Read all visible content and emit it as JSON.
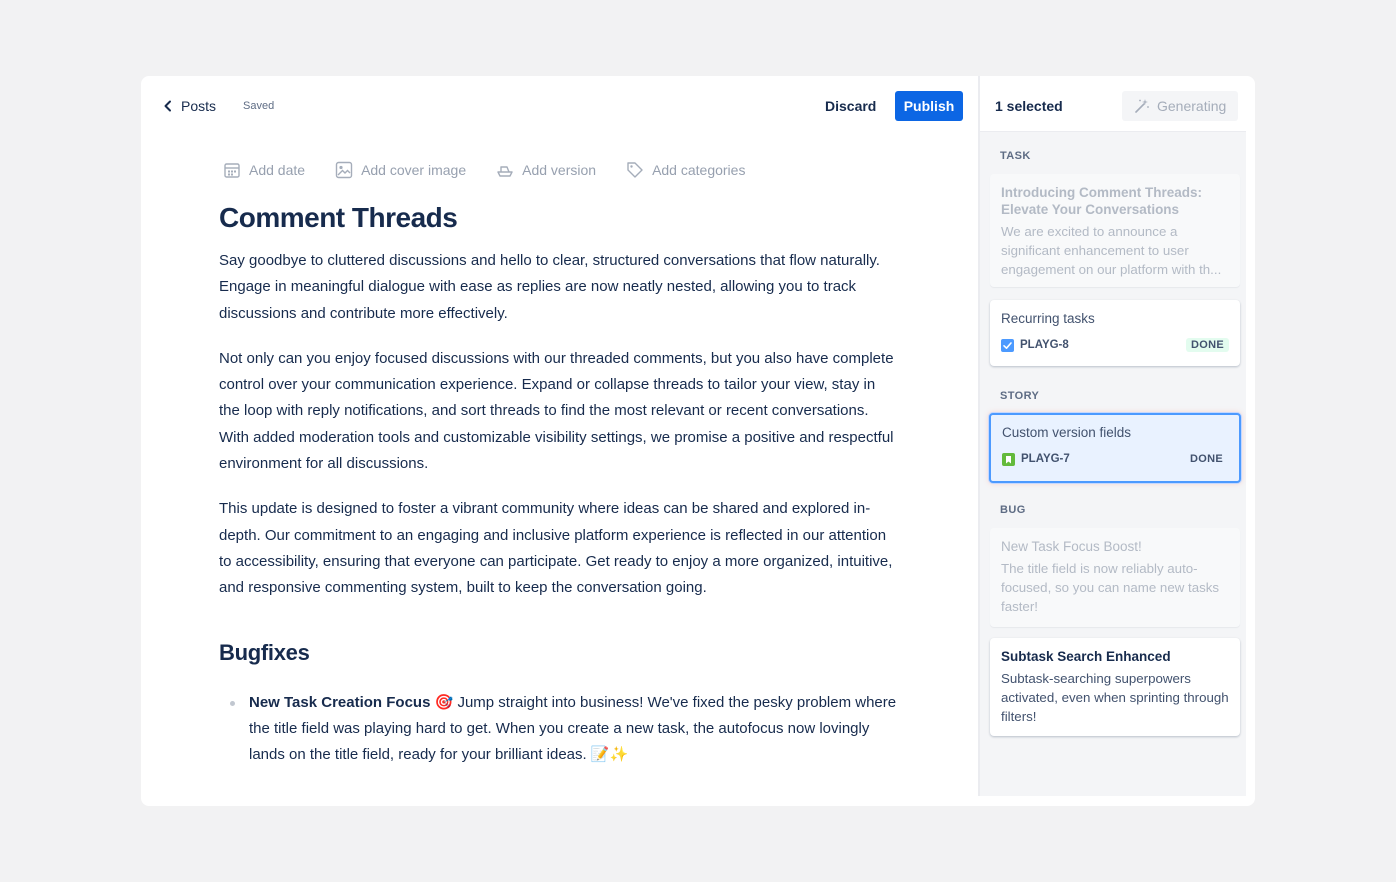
{
  "topbar": {
    "back_label": "Posts",
    "saved_label": "Saved",
    "discard_label": "Discard",
    "publish_label": "Publish"
  },
  "meta_actions": {
    "add_date": "Add date",
    "add_cover_image": "Add cover image",
    "add_version": "Add version",
    "add_categories": "Add categories"
  },
  "document": {
    "title": "Comment Threads",
    "paragraphs": [
      "Say goodbye to cluttered discussions and hello to clear, structured conversations that flow naturally. Engage in meaningful dialogue with ease as replies are now neatly nested, allowing you to track discussions and contribute more effectively.",
      "Not only can you enjoy focused discussions with our threaded comments, but you also have complete control over your communication experience. Expand or collapse threads to tailor your view, stay in the loop with reply notifications, and sort threads to find the most relevant or recent conversations. With added moderation tools and customizable visibility settings, we promise a positive and respectful environment for all discussions.",
      "This update is designed to foster a vibrant community where ideas can be shared and explored in-depth. Our commitment to an engaging and inclusive platform experience is reflected in our attention to accessibility, ensuring that everyone can participate. Get ready to enjoy a more organized, intuitive, and responsive commenting system, built to keep the conversation going."
    ],
    "subheading": "Bugfixes",
    "bullets": [
      {
        "bold": "New Task Creation Focus",
        "emoji": "🎯",
        "text": " Jump straight into business! We've fixed the pesky problem where the title field was playing hard to get. When you create a new task, the autofocus now lovingly lands on the title field, ready for your brilliant ideas. 📝✨"
      }
    ]
  },
  "sidebar": {
    "selected_count": "1 selected",
    "generating_label": "Generating",
    "groups": {
      "task": "TASK",
      "story": "STORY",
      "bug": "BUG"
    },
    "cards": [
      {
        "title": "Introducing Comment Threads: Elevate Your Conversations",
        "desc": "We are excited to announce a significant enhancement to user engagement on our platform with th..."
      },
      {
        "title": "Recurring tasks",
        "key": "PLAYG-8",
        "status": "DONE"
      },
      {
        "title": "Custom version fields",
        "key": "PLAYG-7",
        "status": "DONE"
      },
      {
        "title": "New Task Focus Boost!",
        "desc": "The title field is now reliably auto-focused, so you can name new tasks faster!"
      },
      {
        "title": "Subtask Search Enhanced",
        "desc": "Subtask-searching superpowers activated, even when sprinting through filters!"
      }
    ]
  },
  "colors": {
    "primary": "#0c66e4",
    "text": "#172b4d",
    "muted": "#97a0af",
    "selected_bg": "#e9f2ff",
    "selected_border": "#4c9aff",
    "task_icon": "#4c9aff",
    "story_icon": "#63ba3c"
  },
  "icons": {
    "back": "chevron-left-icon",
    "date": "calendar-icon",
    "cover": "image-icon",
    "version": "ship-icon",
    "categories": "tag-icon",
    "generating": "magic-wand-icon",
    "task": "checkbox-icon",
    "story": "bookmark-icon"
  }
}
